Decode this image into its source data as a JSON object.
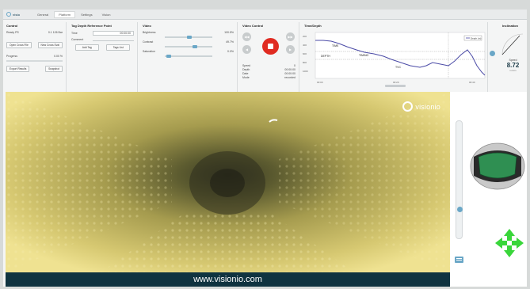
{
  "app": {
    "logo_text": "visio",
    "tabs": [
      "General",
      "Platform",
      "Settings",
      "Vision"
    ],
    "active_tab": 1
  },
  "control": {
    "title": "Control",
    "rows": [
      {
        "label": "Ready PS",
        "value": "0.1 126 Bar"
      },
      {
        "label": "Progress",
        "value": "0.00 %"
      }
    ],
    "buttons": [
      "Open Cross File",
      "New Cross Eval",
      "Export Results",
      "Snapshot"
    ]
  },
  "tag_depth": {
    "title": "Tag Depth Reference Point",
    "time_label": "Time",
    "time_value": "00:00:00",
    "comment_label": "Comment",
    "buttons": [
      "Add Tag",
      "Tags List"
    ]
  },
  "video": {
    "title": "Video",
    "brightness_label": "Brightness",
    "brightness_value": "100.5%",
    "contrast_label": "Contrast",
    "contrast_value": "49.7%",
    "saturation_label": "Saturation",
    "saturation_value": "0.0%",
    "brightness_level": 0.52,
    "contrast_level": 0.65,
    "saturation_level": 0.05
  },
  "video_control": {
    "title": "Video Control",
    "rows": [
      {
        "label": "Speed",
        "value": "0"
      },
      {
        "label": "Depth",
        "value": "00:00:00"
      },
      {
        "label": "Date",
        "value": "00:00:00"
      },
      {
        "label": "Mode",
        "value": "recorded"
      }
    ]
  },
  "time_depth": {
    "title": "Time/Depth",
    "legend_label": "Depth (m)",
    "labels": [
      "TIME",
      "DEPTH",
      "TIMING",
      "TVC"
    ],
    "y_ticks": [
      "200",
      "400",
      "600",
      "800",
      "1000"
    ],
    "x_ticks": [
      "00:00",
      "00:20",
      "00:40"
    ]
  },
  "inclination": {
    "title": "Inclination",
    "speed_label": "Speed",
    "speed_value": "8.72",
    "speed_unit": "m/min"
  },
  "video_overlay": {
    "brand": "visionio",
    "url": "www.visionio.com"
  },
  "colors": {
    "accent": "#6aa7c7",
    "record": "#e02b21",
    "arrow": "#39d63a",
    "screen": "#2f8f52"
  }
}
